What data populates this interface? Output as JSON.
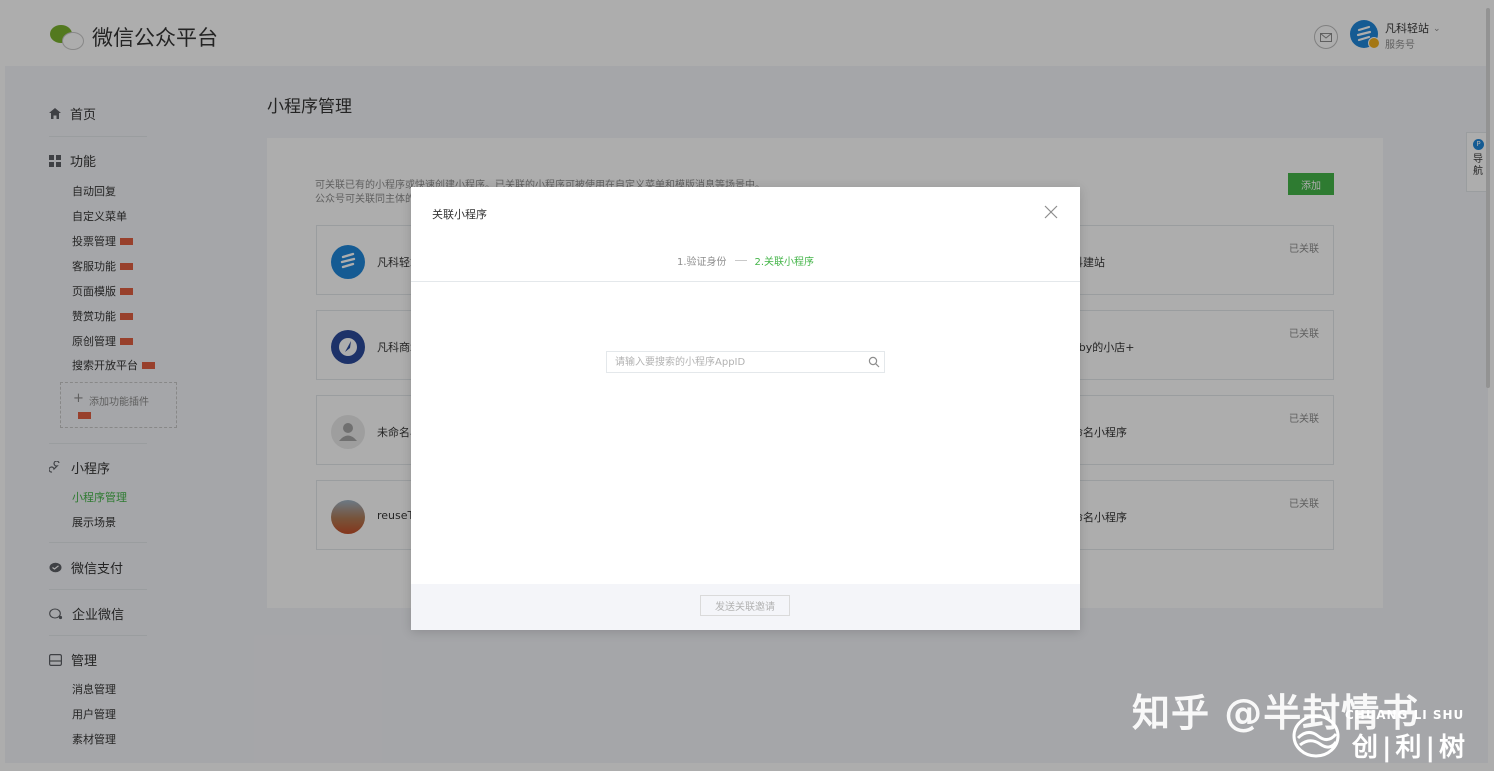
{
  "header": {
    "brand_name": "微信公众平台",
    "account_name": "凡科轻站",
    "account_type": "服务号",
    "caret": "⌄"
  },
  "sidebar": {
    "home": "首页",
    "functions": {
      "title": "功能",
      "items": [
        "自动回复",
        "自定义菜单",
        "投票管理",
        "客服功能",
        "页面模版",
        "赞赏功能",
        "原创管理",
        "搜索开放平台"
      ],
      "add_plugin": "添加功能插件"
    },
    "miniprogram": {
      "title": "小程序",
      "items": [
        "小程序管理",
        "展示场景"
      ]
    },
    "wechat_pay": "微信支付",
    "wecom": "企业微信",
    "manage": {
      "title": "管理",
      "items": [
        "消息管理",
        "用户管理",
        "素材管理"
      ]
    }
  },
  "main": {
    "page_title": "小程序管理",
    "desc_line1": "可关联已有的小程序或快速创建小程序。已关联的小程序可被使用在自定义菜单和模版消息等场景中。",
    "desc_line2": "公众号可关联同主体的",
    "add_button": "添加",
    "cards": [
      {
        "left_name": "凡科轻站",
        "right_name": "科建站",
        "status": "已关联"
      },
      {
        "left_name": "凡科商城",
        "right_name": "oby的小店+",
        "status": "已关联"
      },
      {
        "left_name": "未命名小",
        "right_name": "命名小程序",
        "status": "已关联"
      },
      {
        "left_name": "reuseTe",
        "right_name": "命名小程序",
        "status": "已关联"
      }
    ]
  },
  "modal": {
    "title": "关联小程序",
    "step1": "1.验证身份",
    "step2": "2.关联小程序",
    "search_placeholder": "请输入要搜索的小程序AppID",
    "search_value": "",
    "send_button": "发送关联邀请"
  },
  "side_tab": {
    "badge": "P",
    "text": "导航"
  },
  "watermark": {
    "zhihu": "知乎 @半封情书",
    "small": "CHUANG LI SHU",
    "brand": "创|利|树"
  },
  "colors": {
    "accent_green": "#44b549",
    "tag_red": "#e15f41",
    "link_blue": "#1f86d9"
  }
}
